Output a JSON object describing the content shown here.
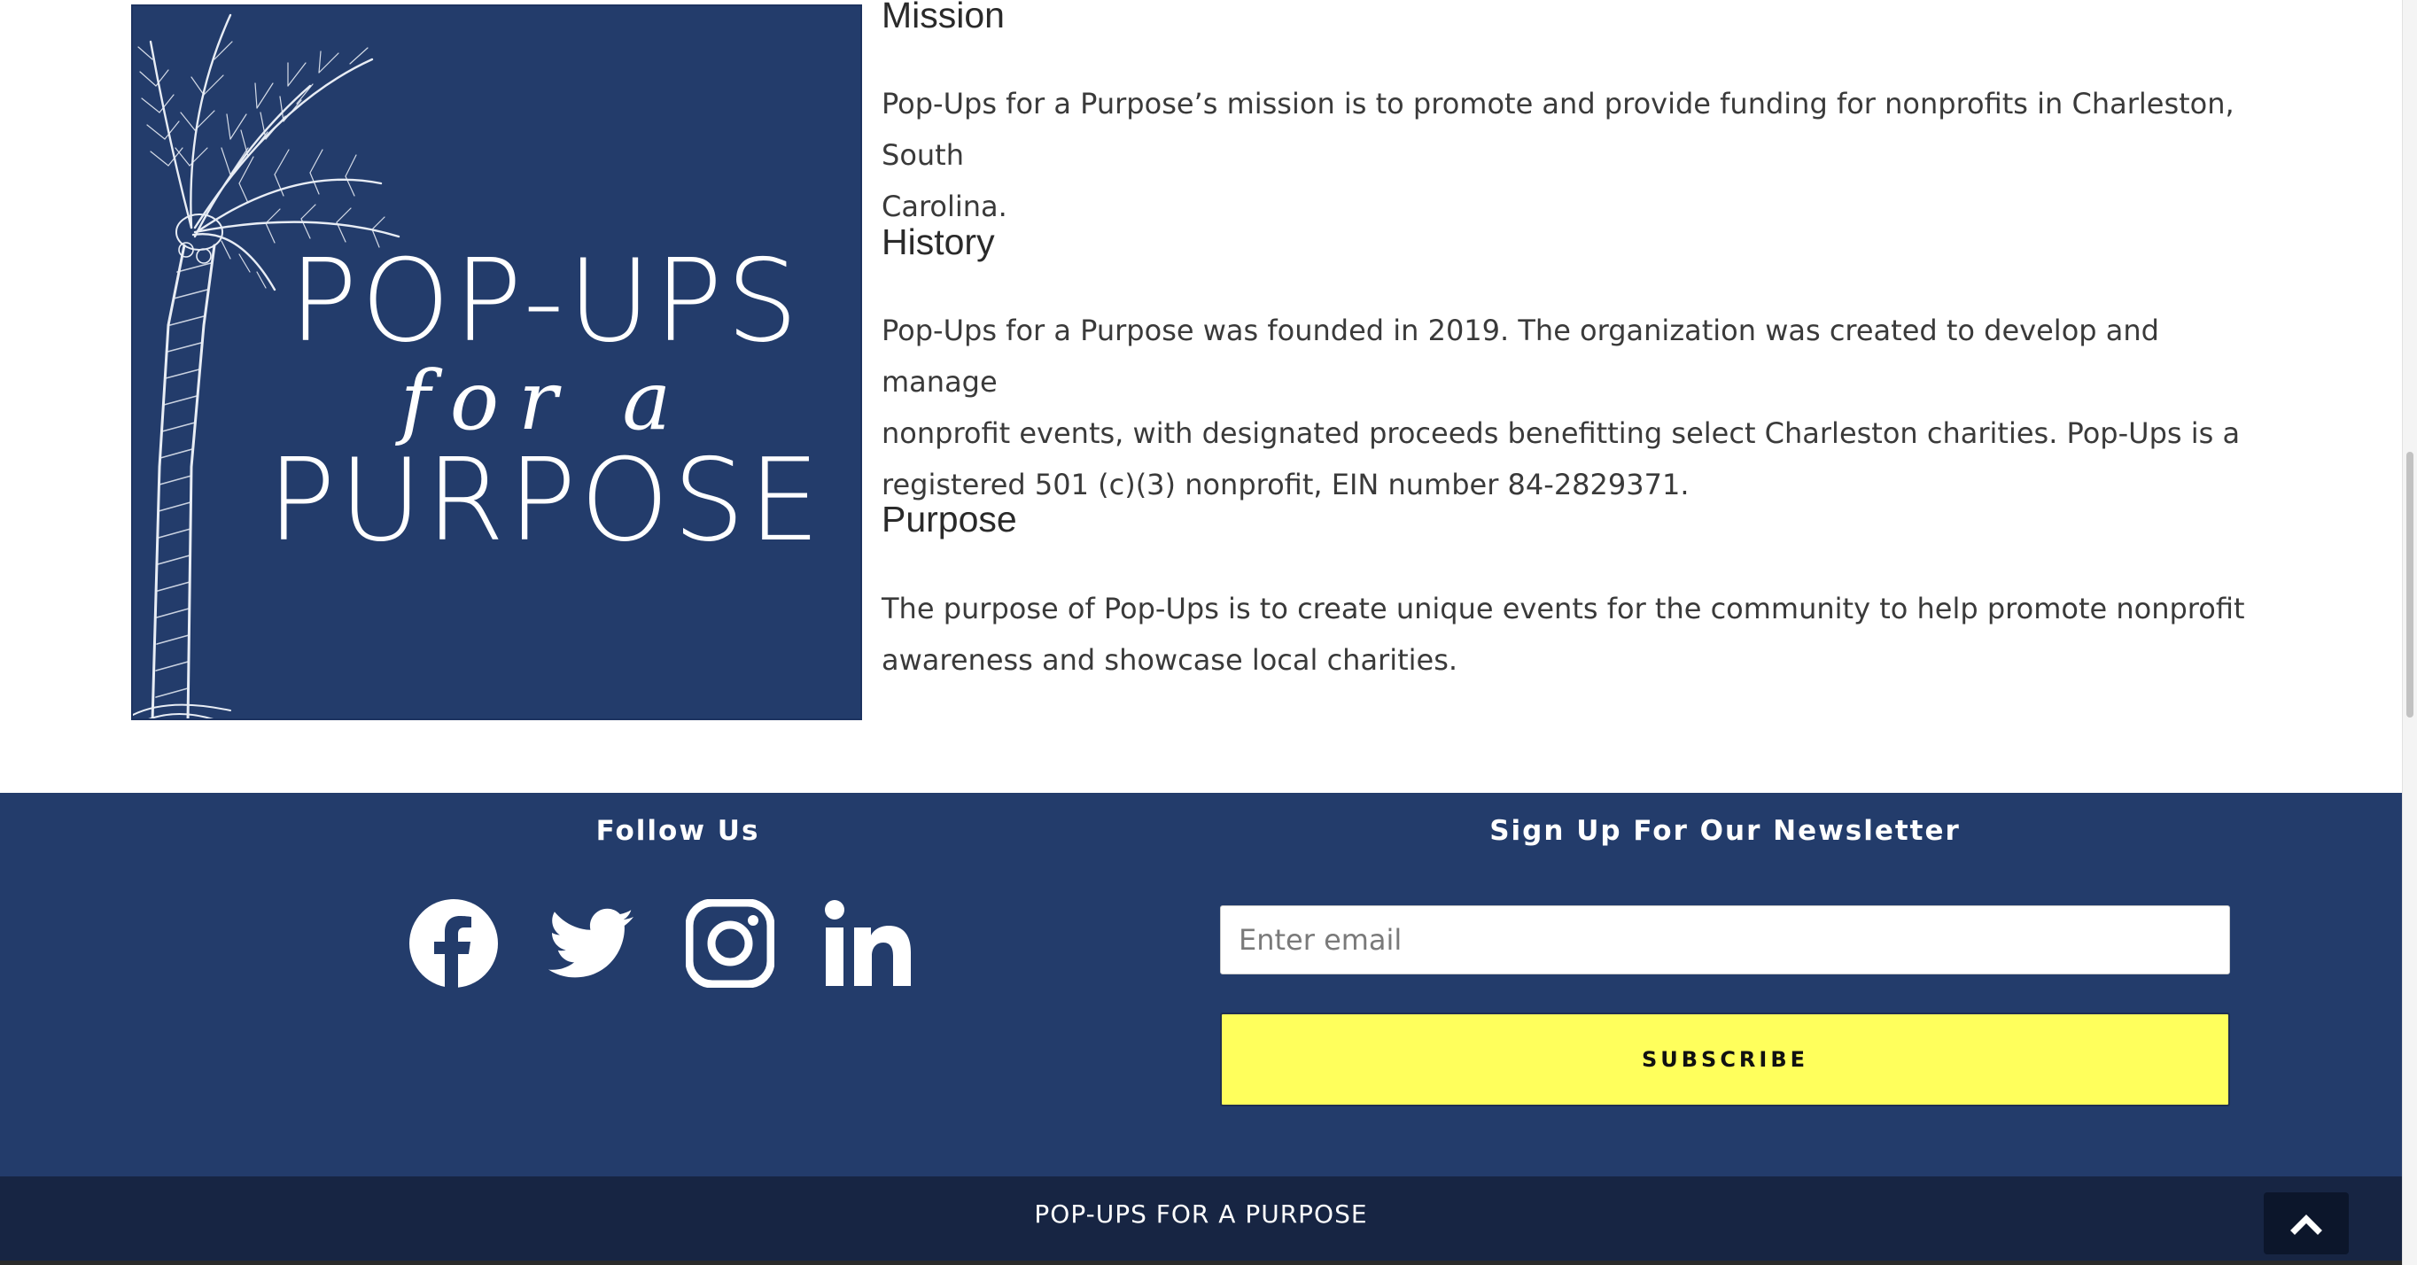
{
  "logo": {
    "line1": "POP-UPS",
    "line2": "for a",
    "line3": "PURPOSE",
    "background": "#233c6b"
  },
  "sections": [
    {
      "heading": "Mission",
      "paragraph_lines": [
        "Pop-Ups for a Purpose’s mission is to promote and provide funding for nonprofits in Charleston, South",
        "Carolina."
      ]
    },
    {
      "heading": "History",
      "paragraph_lines": [
        "Pop-Ups for a Purpose was founded in 2019. The organization was created to develop and manage",
        "nonprofit events, with designated proceeds benefitting select Charleston charities. Pop-Ups is a",
        "registered 501 (c)(3) nonprofit, EIN number 84-2829371."
      ]
    },
    {
      "heading": "Purpose",
      "paragraph_lines": [
        "The purpose of Pop-Ups is to create unique events for the community to help promote nonprofit",
        "awareness and showcase local charities."
      ]
    }
  ],
  "footer": {
    "follow_heading": "Follow Us",
    "social_icons": [
      "facebook-icon",
      "twitter-icon",
      "instagram-icon",
      "linkedin-icon"
    ],
    "newsletter_heading": "Sign Up For Our Newsletter",
    "email_placeholder": "Enter email",
    "subscribe_label": "SUBSCRIBE",
    "bottom_title": "POP-UPS FOR A PURPOSE",
    "to_top_icon": "chevron-up-icon",
    "colors": {
      "footer_bg": "#233c6b",
      "bottom_bar_bg": "#172543",
      "subscribe_bg": "#ffff5c"
    }
  }
}
